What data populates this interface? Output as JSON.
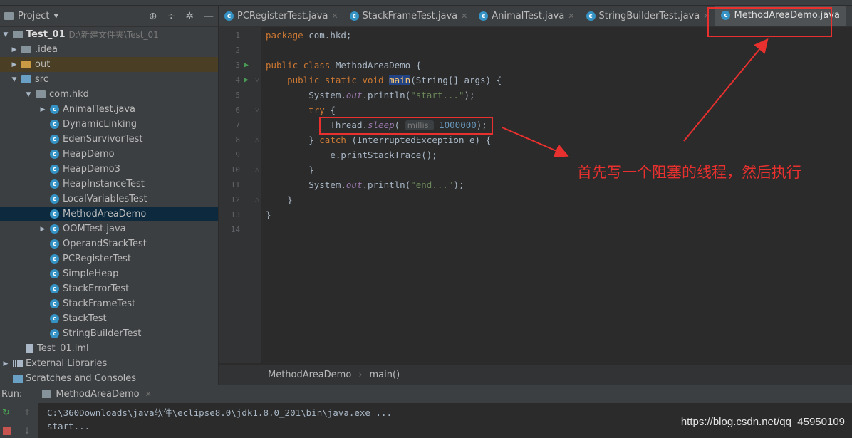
{
  "project_panel": {
    "title": "Project",
    "tree": [
      {
        "label": "Test_01",
        "path": "D:\\新建文件夹\\Test_01",
        "icon": "project-folder-icon"
      },
      {
        "label": ".idea",
        "icon": "folder-icon"
      },
      {
        "label": "out",
        "icon": "folder-icon"
      },
      {
        "label": "src",
        "icon": "folder-icon"
      },
      {
        "label": "com.hkd",
        "icon": "package-icon"
      },
      {
        "label": "AnimalTest.java",
        "icon": "class-icon"
      },
      {
        "label": "DynamicLinking",
        "icon": "class-icon"
      },
      {
        "label": "EdenSurvivorTest",
        "icon": "class-icon"
      },
      {
        "label": "HeapDemo",
        "icon": "class-icon"
      },
      {
        "label": "HeapDemo3",
        "icon": "class-icon"
      },
      {
        "label": "HeapInstanceTest",
        "icon": "class-icon"
      },
      {
        "label": "LocalVariablesTest",
        "icon": "class-icon"
      },
      {
        "label": "MethodAreaDemo",
        "icon": "class-icon",
        "selected": true
      },
      {
        "label": "OOMTest.java",
        "icon": "class-icon"
      },
      {
        "label": "OperandStackTest",
        "icon": "class-icon"
      },
      {
        "label": "PCRegisterTest",
        "icon": "class-icon"
      },
      {
        "label": "SimpleHeap",
        "icon": "class-icon"
      },
      {
        "label": "StackErrorTest",
        "icon": "class-icon"
      },
      {
        "label": "StackFrameTest",
        "icon": "class-icon"
      },
      {
        "label": "StackTest",
        "icon": "class-icon"
      },
      {
        "label": "StringBuilderTest",
        "icon": "class-icon"
      },
      {
        "label": "Test_01.iml",
        "icon": "iml-file-icon"
      },
      {
        "label": "External Libraries",
        "icon": "libraries-icon"
      },
      {
        "label": "Scratches and Consoles",
        "icon": "scratches-icon"
      }
    ]
  },
  "tabs": [
    {
      "label": "PCRegisterTest.java"
    },
    {
      "label": "StackFrameTest.java"
    },
    {
      "label": "AnimalTest.java"
    },
    {
      "label": "StringBuilderTest.java"
    },
    {
      "label": "MethodAreaDemo.java",
      "active": true
    }
  ],
  "editor": {
    "line_numbers": [
      "1",
      "2",
      "3",
      "4",
      "5",
      "6",
      "7",
      "8",
      "9",
      "10",
      "11",
      "12",
      "13",
      "14"
    ],
    "code": {
      "l1_kw": "package",
      "l1_rest": " com.hkd;",
      "l3_kw": "public class",
      "l3_rest": " MethodAreaDemo {",
      "l4_kw": "public static void",
      "l4_fn": "main",
      "l4_rest": "(String[] args) {",
      "l5_a": "System.",
      "l5_out": "out",
      "l5_b": ".println(",
      "l5_str": "\"start...\"",
      "l5_c": ");",
      "l6_kw": "try",
      "l6_rest": " {",
      "l7_a": "Thread.",
      "l7_sleep": "sleep",
      "l7_b": "( ",
      "l7_hint": "millis:",
      "l7_num": "1000000",
      "l7_c": ");",
      "l8_a": "} ",
      "l8_kw": "catch",
      "l8_rest": " (InterruptedException e) {",
      "l9": "e.printStackTrace();",
      "l10": "}",
      "l11_a": "System.",
      "l11_out": "out",
      "l11_b": ".println(",
      "l11_str": "\"end...\"",
      "l11_c": ");",
      "l12": "}",
      "l13": "}"
    }
  },
  "annotation": {
    "text": "首先写一个阻塞的线程，然后执行",
    "color": "#e8302e"
  },
  "breadcrumb": {
    "class": "MethodAreaDemo",
    "method": "main()"
  },
  "run": {
    "label": "Run:",
    "tab": "MethodAreaDemo",
    "console_lines": [
      "C:\\360Downloads\\java软件\\eclipse8.0\\jdk1.8.0_201\\bin\\java.exe ...",
      "start..."
    ]
  },
  "watermark": "https://blog.csdn.net/qq_45950109"
}
